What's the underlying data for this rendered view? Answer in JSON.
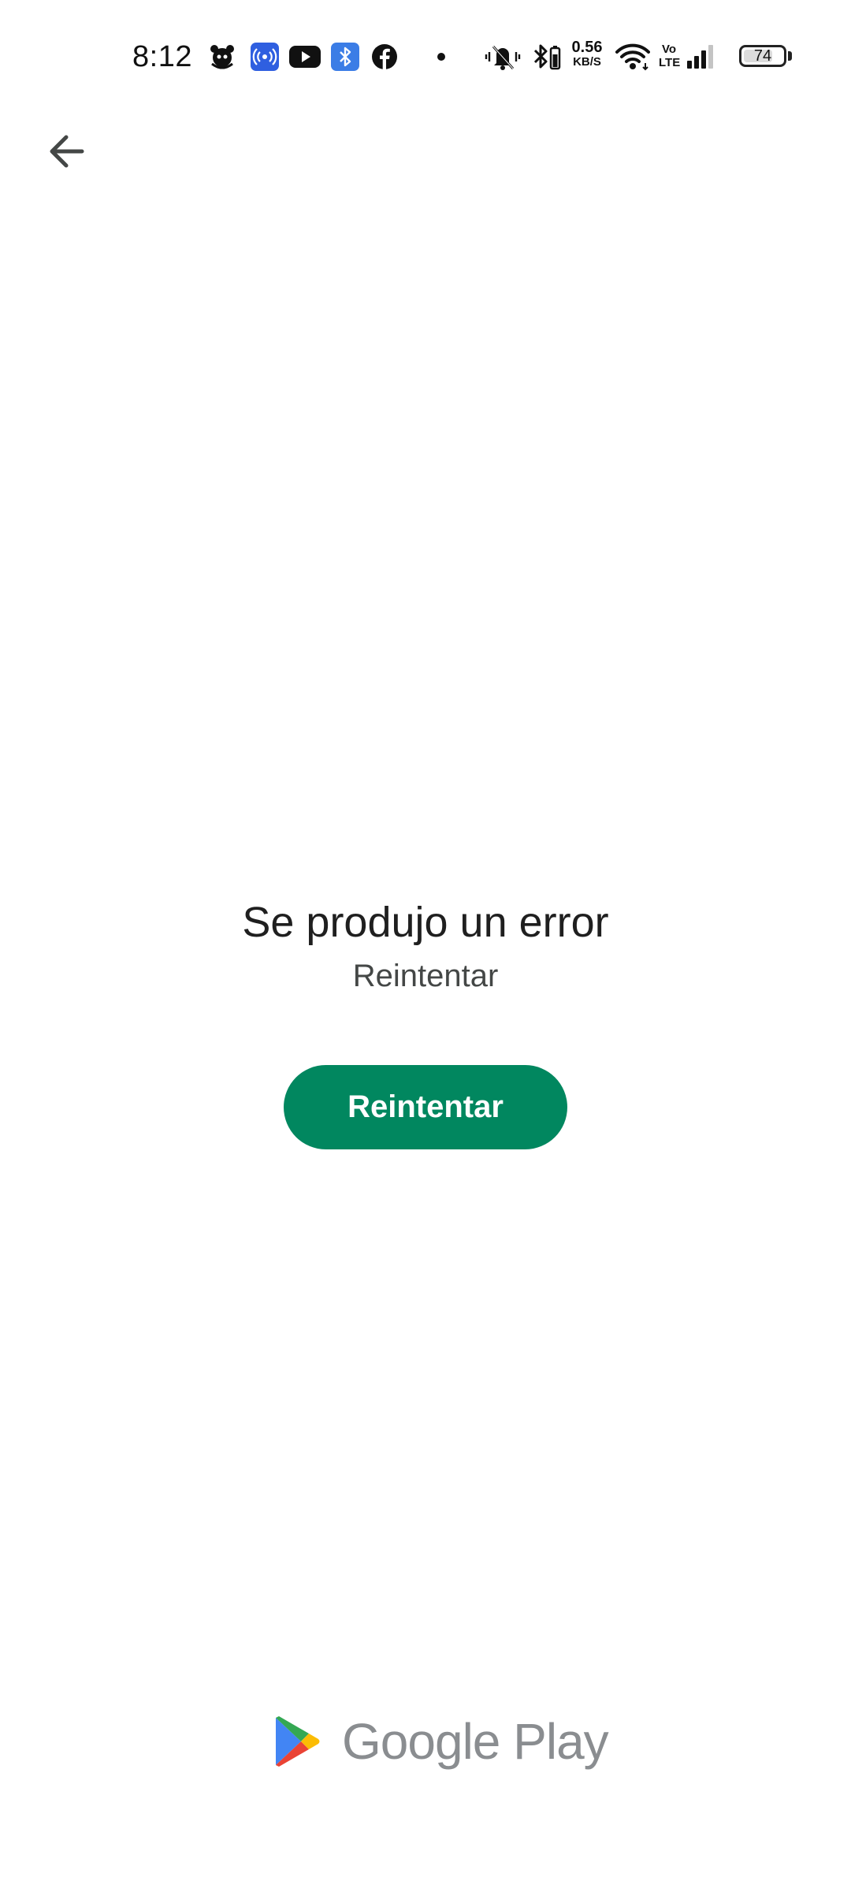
{
  "status_bar": {
    "time": "8:12",
    "net_speed_value": "0.56",
    "net_speed_unit": "KB/S",
    "volte_top": "Vo",
    "volte_bottom": "LTE",
    "battery_level": "74",
    "battery_fraction": 0.74,
    "notification_icons": [
      "pet-app-icon",
      "hotspot-icon",
      "youtube-icon",
      "bluetooth-app-icon",
      "facebook-icon",
      "more-dot-icon"
    ],
    "system_icons": [
      "mute-vibrate-icon",
      "bluetooth-battery-icon",
      "wifi-icon",
      "volte-icon",
      "cellular-signal-icon",
      "battery-icon"
    ]
  },
  "toolbar": {
    "back_icon": "arrow-back-icon"
  },
  "error": {
    "title": "Se produjo un error",
    "subtitle": "Reintentar",
    "retry_label": "Reintentar"
  },
  "footer": {
    "logo_icon": "google-play-logo-icon",
    "logo_text": "Google Play"
  },
  "colors": {
    "accent": "#01875f",
    "background": "#ffffff",
    "title_text": "#1f1f1f",
    "subtitle_text": "#444746",
    "logo_text": "#8a8d90"
  }
}
